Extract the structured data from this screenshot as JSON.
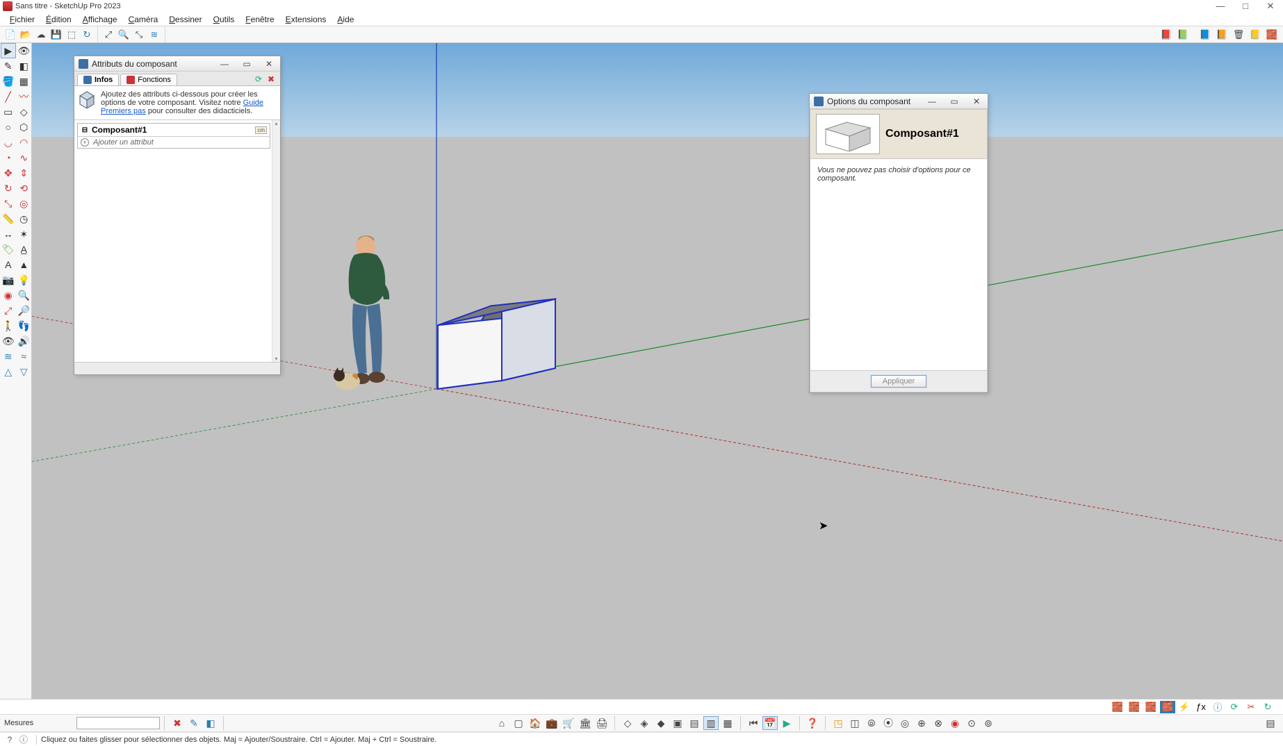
{
  "window": {
    "title": "Sans titre - SketchUp Pro 2023",
    "controls": {
      "min": "—",
      "max": "□",
      "close": "✕"
    }
  },
  "menu": [
    "Fichier",
    "Édition",
    "Affichage",
    "Caméra",
    "Dessiner",
    "Outils",
    "Fenêtre",
    "Extensions",
    "Aide"
  ],
  "attr_panel": {
    "title": "Attributs du composant",
    "controls": {
      "min": "—",
      "max": "▭",
      "close": "✕"
    },
    "tabs": {
      "info": "Infos",
      "func": "Fonctions"
    },
    "info_pre": "Ajoutez des attributs ci-dessous pour créer les options de votre composant. Visitez notre ",
    "info_link": "Guide Premiers pas",
    "info_post": " pour consulter des didacticiels.",
    "component_name": "Composant#1",
    "unit_badge": "cm",
    "add_attr": "Ajouter un attribut"
  },
  "opt_panel": {
    "title": "Options du composant",
    "controls": {
      "min": "—",
      "max": "▭",
      "close": "✕"
    },
    "name": "Composant#1",
    "msg": "Vous ne pouvez pas choisir d'options pour ce composant.",
    "apply": "Appliquer"
  },
  "measures": {
    "label": "Mesures",
    "value": ""
  },
  "status": "Cliquez ou faites glisser pour sélectionner des objets. Maj = Ajouter/Soustraire. Ctrl = Ajouter. Maj + Ctrl = Soustraire."
}
